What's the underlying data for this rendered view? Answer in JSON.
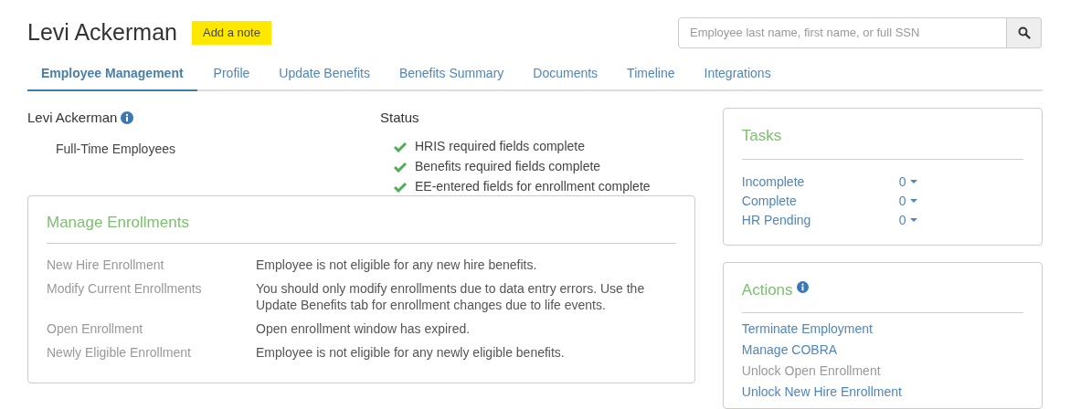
{
  "header": {
    "title": "Levi Ackerman",
    "note_button": "Add a note",
    "search": {
      "placeholder": "Employee last name, first name, or full SSN"
    }
  },
  "tabs": [
    {
      "label": "Employee Management",
      "selected": true
    },
    {
      "label": "Profile",
      "selected": false
    },
    {
      "label": "Update Benefits",
      "selected": false
    },
    {
      "label": "Benefits Summary",
      "selected": false
    },
    {
      "label": "Documents",
      "selected": false
    },
    {
      "label": "Timeline",
      "selected": false
    },
    {
      "label": "Integrations",
      "selected": false
    }
  ],
  "employee": {
    "name": "Levi Ackerman",
    "group": "Full-Time Employees"
  },
  "status": {
    "title": "Status",
    "items": [
      {
        "label": "HRIS required fields complete",
        "complete": true
      },
      {
        "label": "Benefits required fields complete",
        "complete": true
      },
      {
        "label": "EE-entered fields for enrollment complete",
        "complete": true
      }
    ]
  },
  "manage_enrollments": {
    "title": "Manage Enrollments",
    "rows": [
      {
        "label": "New Hire Enrollment",
        "text": "Employee is not eligible for any new hire benefits."
      },
      {
        "label": "Modify Current Enrollments",
        "text": "You should only modify enrollments due to data entry errors. Use the Update Benefits tab for enrollment changes due to life events."
      },
      {
        "label": "Open Enrollment",
        "text": "Open enrollment window has expired."
      },
      {
        "label": "Newly Eligible Enrollment",
        "text": "Employee is not eligible for any newly eligible benefits."
      }
    ]
  },
  "tasks": {
    "title": "Tasks",
    "rows": [
      {
        "label": "Incomplete",
        "count": "0"
      },
      {
        "label": "Complete",
        "count": "0"
      },
      {
        "label": "HR Pending",
        "count": "0"
      }
    ]
  },
  "actions": {
    "title": "Actions",
    "items": [
      {
        "label": "Terminate Employment",
        "disabled": false
      },
      {
        "label": "Manage COBRA",
        "disabled": false
      },
      {
        "label": "Unlock Open Enrollment",
        "disabled": true
      },
      {
        "label": "Unlock New Hire Enrollment",
        "disabled": false
      }
    ]
  }
}
